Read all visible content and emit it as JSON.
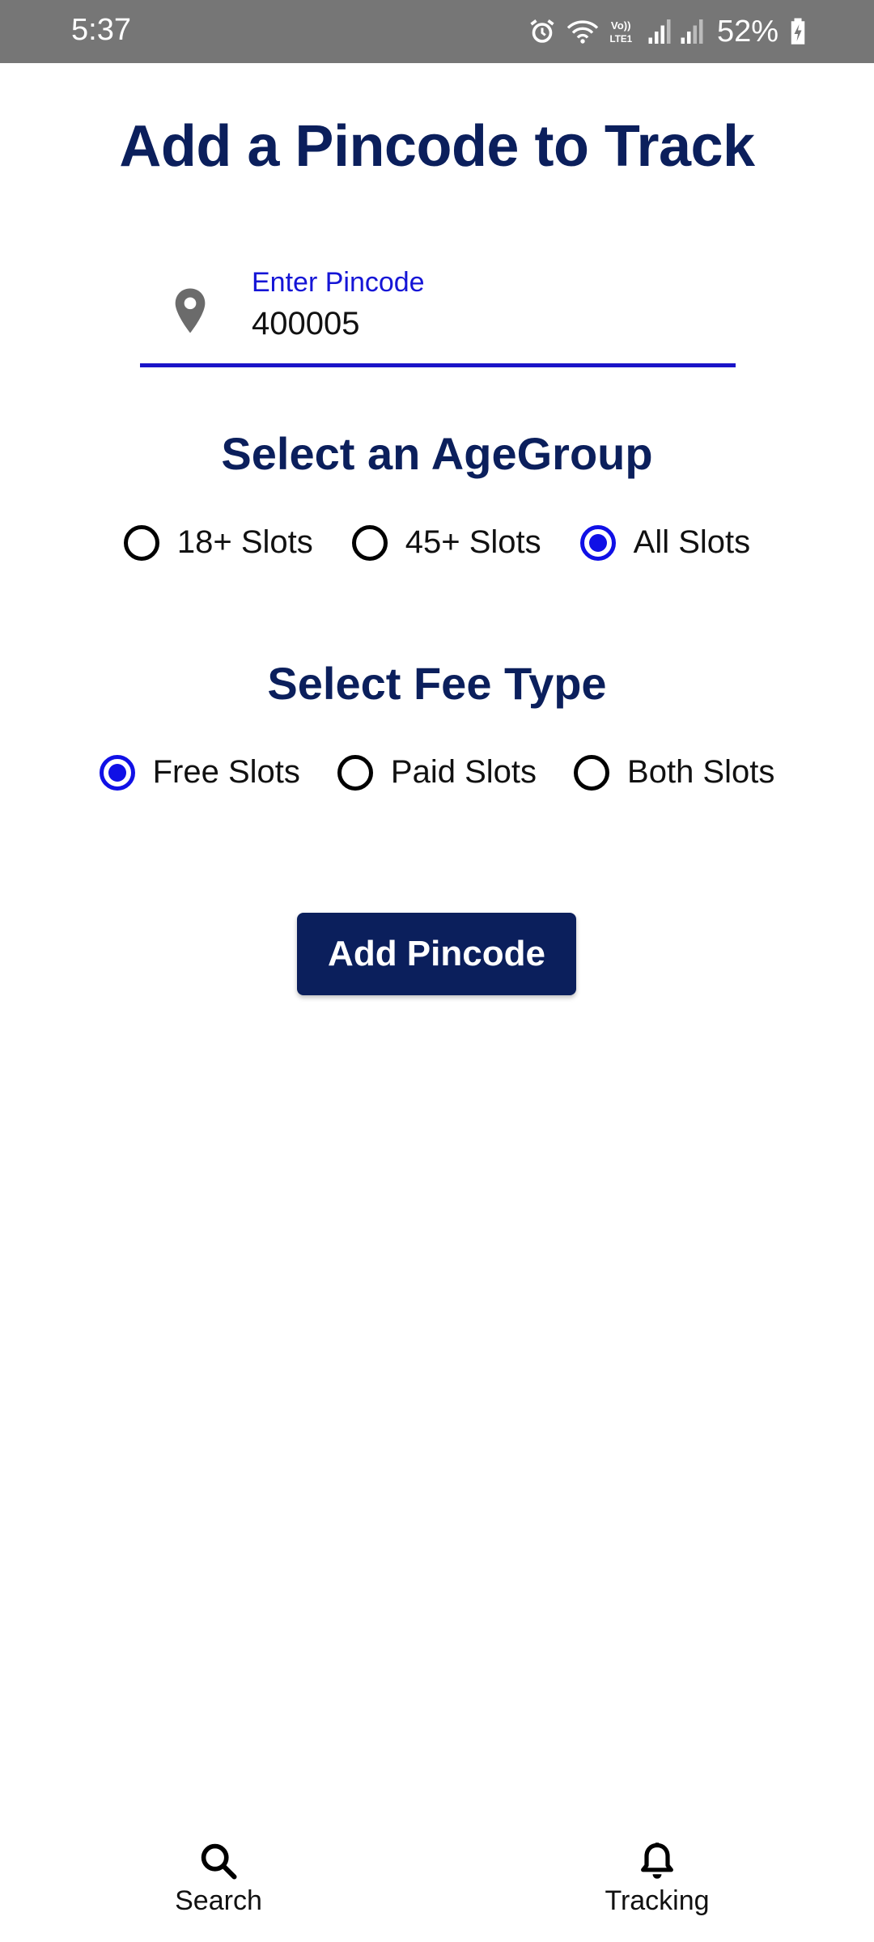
{
  "status_bar": {
    "time": "5:37",
    "battery": "52%",
    "icons": [
      "alarm-icon",
      "wifi-icon",
      "volte-icon",
      "signal-icon",
      "signal-icon",
      "battery-charging-icon"
    ]
  },
  "page": {
    "title": "Add a Pincode to Track"
  },
  "pincode": {
    "label": "Enter Pincode",
    "value": "400005",
    "icon": "location-pin-icon"
  },
  "age_group": {
    "title": "Select an AgeGroup",
    "options": [
      {
        "label": "18+ Slots",
        "selected": false
      },
      {
        "label": "45+ Slots",
        "selected": false
      },
      {
        "label": "All Slots",
        "selected": true
      }
    ]
  },
  "fee_type": {
    "title": "Select Fee Type",
    "options": [
      {
        "label": "Free Slots",
        "selected": true
      },
      {
        "label": "Paid Slots",
        "selected": false
      },
      {
        "label": "Both Slots",
        "selected": false
      }
    ]
  },
  "add_button": {
    "label": "Add Pincode"
  },
  "bottom_nav": {
    "items": [
      {
        "label": "Search",
        "icon": "search-icon"
      },
      {
        "label": "Tracking",
        "icon": "bell-icon"
      }
    ]
  },
  "colors": {
    "primary": "#0b1f5c",
    "accent": "#1010e6",
    "status_bar": "#767676"
  }
}
